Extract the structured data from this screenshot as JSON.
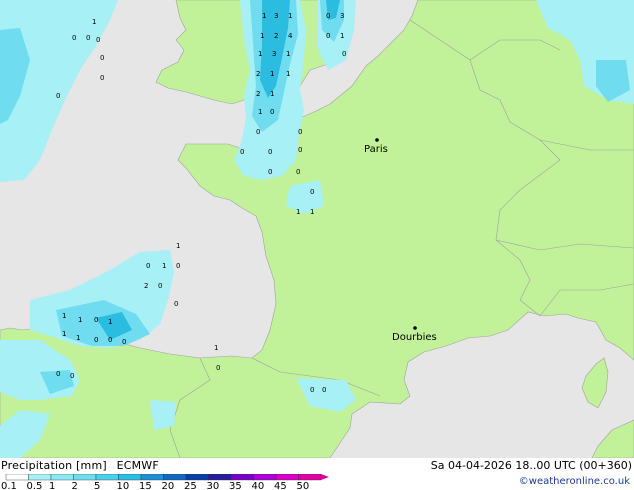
{
  "map": {
    "cities": [
      {
        "name": "Paris",
        "id": "paris"
      },
      {
        "name": "Dourbies",
        "id": "dourbies"
      }
    ],
    "colors": {
      "sea": "#e6e6e6",
      "land": "#c1f29a",
      "precip_light": "#a6f0f6",
      "precip_medium": "#6fdcef",
      "precip_heavy": "#2bbde0",
      "border": "#a0a0a0"
    },
    "grid_values": [
      "1",
      "3",
      "1",
      "0",
      "3",
      "1",
      "2",
      "4",
      "0",
      "1",
      "1",
      "3",
      "1",
      "0",
      "2",
      "1",
      "1",
      "2",
      "1",
      "1",
      "0",
      "0",
      "0",
      "0",
      "0",
      "0",
      "0",
      "0",
      "0",
      "1",
      "1",
      "1",
      "0",
      "1",
      "0",
      "2",
      "0",
      "0",
      "1",
      "1",
      "0",
      "1",
      "1",
      "1",
      "0",
      "0",
      "0",
      "0",
      "0",
      "0",
      "0",
      "1",
      "0",
      "1",
      "0",
      "0",
      "0",
      "0",
      "0",
      "0"
    ]
  },
  "legend": {
    "title": "Precipitation [mm]",
    "model": "ECMWF",
    "datetime": "Sa 04-04-2026 18..00 UTC (00+360)",
    "credit": "©weatheronline.co.uk",
    "scale_labels": [
      "0.1",
      "0.5",
      "1",
      "2",
      "5",
      "10",
      "15",
      "20",
      "25",
      "30",
      "35",
      "40",
      "45",
      "50"
    ],
    "scale_colors": [
      "#fefefe",
      "#a6f0f6",
      "#8ae8f3",
      "#6fdcef",
      "#4ccfea",
      "#2bbde0",
      "#1c8fd4",
      "#1466c2",
      "#0a3ea8",
      "#2a1c9e",
      "#7a00c8",
      "#b000d8",
      "#d800c8",
      "#e000a0"
    ]
  }
}
